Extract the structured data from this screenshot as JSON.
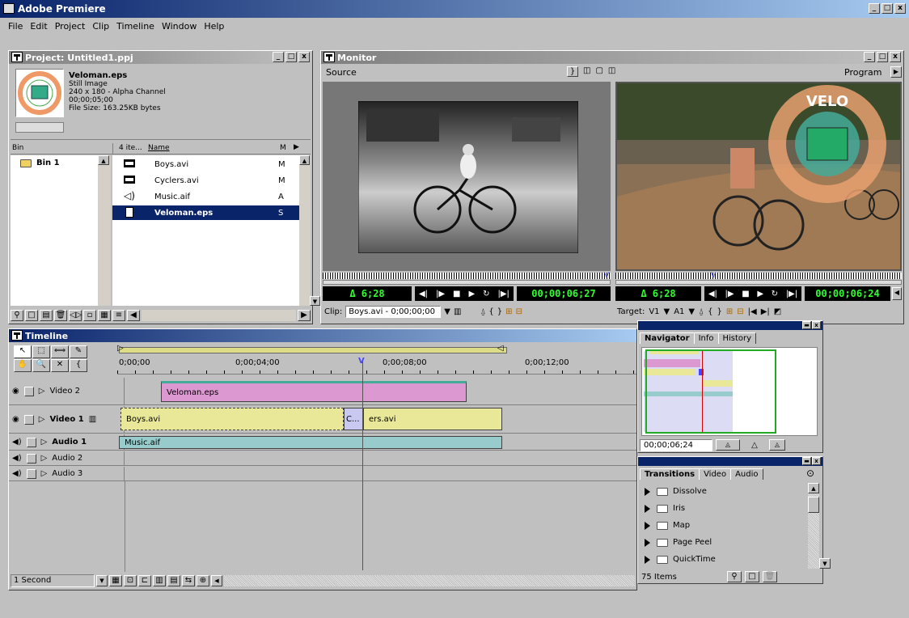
{
  "app": {
    "title": "Adobe Premiere"
  },
  "menu": [
    "File",
    "Edit",
    "Project",
    "Clip",
    "Timeline",
    "Window",
    "Help"
  ],
  "project": {
    "title": "Project: Untitled1.ppj",
    "preview": {
      "name": "Veloman.eps",
      "type": "Still Image",
      "dims": "240 x 180 - Alpha Channel",
      "duration": "00;00;05;00",
      "size": "File Size: 163.25KB bytes"
    },
    "bin_header": "Bin",
    "bin_name": "Bin 1",
    "items_header": "4 ite...",
    "name_header": "Name",
    "m_header": "M",
    "items": [
      {
        "name": "Boys.avi",
        "m": "M",
        "icon": "film-icon"
      },
      {
        "name": "Cyclers.avi",
        "m": "M",
        "icon": "film-icon"
      },
      {
        "name": "Music.aif",
        "m": "A",
        "icon": "speaker-icon"
      },
      {
        "name": "Veloman.eps",
        "m": "S",
        "icon": "document-icon"
      }
    ]
  },
  "monitor": {
    "title": "Monitor",
    "source_label": "Source",
    "program_label": "Program",
    "source_duration": "Δ 6;28",
    "source_tc": "00;00;06;27",
    "program_duration": "Δ 6;28",
    "program_tc": "00;00;06;24",
    "clip_label": "Clip:",
    "clip_value": "Boys.avi - 0;00;00;00",
    "target_label": "Target:",
    "target_v": "V1",
    "target_a": "A1",
    "logo_text": "VELO"
  },
  "timeline": {
    "title": "Timeline",
    "ruler": [
      "0;00;00",
      "0;00;04;00",
      "0;00;08;00",
      "0;00;12;00"
    ],
    "tracks": [
      {
        "name": "Video 2",
        "bold": false
      },
      {
        "name": "Video 1",
        "bold": true
      },
      {
        "name": "Audio 1",
        "bold": true
      },
      {
        "name": "Audio 2",
        "bold": false
      },
      {
        "name": "Audio 3",
        "bold": false
      }
    ],
    "clips": {
      "veloman": "Veloman.eps",
      "boys": "Boys.avi",
      "transition": "C...",
      "cyclers": "ers.avi",
      "music": "Music.aif"
    },
    "scale": "1 Second"
  },
  "navigator": {
    "tabs": [
      "Navigator",
      "Info",
      "History"
    ],
    "tc": "00;00;06;24"
  },
  "transitions": {
    "tabs": [
      "Transitions",
      "Video",
      "Audio"
    ],
    "items": [
      "Dissolve",
      "Iris",
      "Map",
      "Page Peel",
      "QuickTime"
    ],
    "count": "75 Items"
  },
  "colors": {
    "title_active": "#0a246a",
    "clip_pink": "#dc98d0",
    "clip_yellow": "#e8e898",
    "clip_teal": "#98cccc",
    "timecode_green": "#2fff2f"
  }
}
